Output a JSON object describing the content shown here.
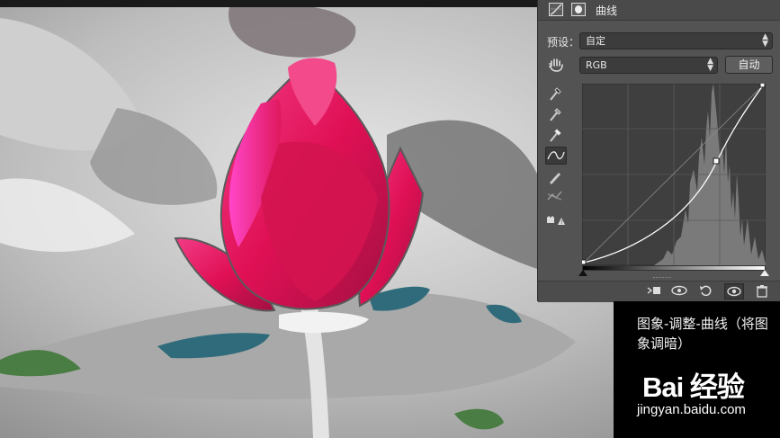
{
  "panel": {
    "title": "曲线",
    "preset_label": "预设：",
    "preset_value": "自定",
    "channel_value": "RGB",
    "auto_label": "自动"
  },
  "caption": {
    "text": "图象-调整-曲线（将图象调暗）",
    "logo": "Bai 经验",
    "url": "jingyan.baidu.com"
  },
  "colors": {
    "panel_bg": "#535353",
    "curve": "#ffffff",
    "lotus": "#e8175d"
  },
  "icons": [
    "curves-icon",
    "mask-icon",
    "hand-icon",
    "eyedropper-black-icon",
    "eyedropper-gray-icon",
    "eyedropper-white-icon",
    "curve-tool-icon",
    "pencil-icon",
    "smooth-icon",
    "clipping-warning-icon",
    "clip-layer-icon",
    "view-previous-icon",
    "reset-icon",
    "visibility-icon",
    "trash-icon"
  ]
}
